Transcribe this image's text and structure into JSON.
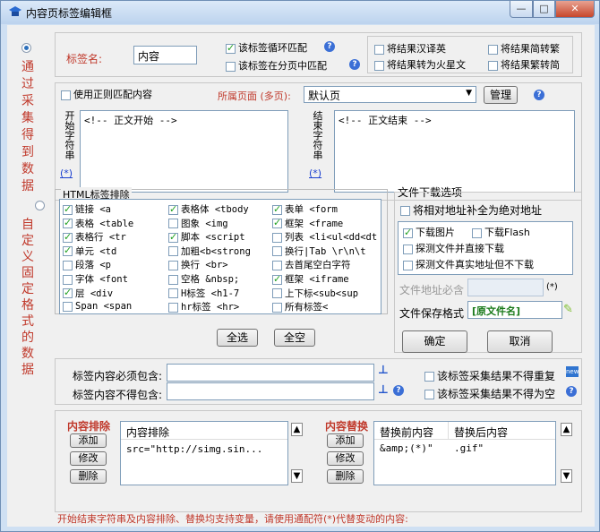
{
  "window": {
    "title": "内容页标签编辑框",
    "min": "—",
    "max": "□",
    "close": "✕"
  },
  "left": {
    "option1": "通过采集得到数据",
    "option2": "自定义固定格式的数据"
  },
  "tag": {
    "label": "标签名:",
    "value": "内容",
    "loop_label": "该标签循环匹配",
    "page_match_label": "该标签在分页中匹配",
    "to_simplified": "将结果汉译英",
    "to_martian": "将结果转为火星文",
    "to_trad": "将结果简转繁",
    "to_simp": "将结果繁转简"
  },
  "regex": {
    "label": "使用正则匹配内容",
    "page_label": "所属页面 (多页):",
    "page_select": "默认页",
    "manage": "管理"
  },
  "start": {
    "vlabel": "开始字符串",
    "text": "<!-- 正文开始 -->",
    "star": "(*)"
  },
  "end": {
    "vlabel": "结束字符串",
    "text": "<!-- 正文结束 -->",
    "star": "(*)"
  },
  "html": {
    "legend": "HTML标签排除",
    "items": [
      {
        "label": "链接 <a",
        "checked": true
      },
      {
        "label": "表格体 <tbody",
        "checked": true
      },
      {
        "label": "表单 <form",
        "checked": true
      },
      {
        "label": "表格 <table",
        "checked": true
      },
      {
        "label": "图象 <img",
        "checked": false
      },
      {
        "label": "框架 <frame",
        "checked": true
      },
      {
        "label": "表格行 <tr",
        "checked": true
      },
      {
        "label": "脚本 <script",
        "checked": true
      },
      {
        "label": "列表 <li<ul<dd<dt",
        "checked": false
      },
      {
        "label": "单元 <td",
        "checked": true
      },
      {
        "label": "加粗<b<strong",
        "checked": false
      },
      {
        "label": "换行|Tab \\r\\n\\t",
        "checked": false
      },
      {
        "label": "段落 <p",
        "checked": false
      },
      {
        "label": "换行 <br>",
        "checked": false
      },
      {
        "label": "去首尾空白字符",
        "checked": false
      },
      {
        "label": "字体 <font",
        "checked": false
      },
      {
        "label": "空格 &nbsp;",
        "checked": false
      },
      {
        "label": "框架 <iframe",
        "checked": true
      },
      {
        "label": "层 <div",
        "checked": true
      },
      {
        "label": "H标签 <h1-7",
        "checked": false
      },
      {
        "label": "上下标<sub<sup",
        "checked": false
      },
      {
        "label": "Span <span",
        "checked": false
      },
      {
        "label": "hr标签 <hr>",
        "checked": false
      },
      {
        "label": "所有标签<",
        "checked": false
      }
    ],
    "select_all": "全选",
    "select_none": "全空"
  },
  "download": {
    "legend": "文件下载选项",
    "absolute": "将相对地址补全为绝对地址",
    "download_images": "下载图片",
    "download_flash": "下载Flash",
    "detect_download": "探测文件并直接下载",
    "detect_real": "探测文件真实地址但不下载",
    "must_contain": "文件地址必含",
    "must_star": "(*)",
    "save_format_label": "文件保存格式",
    "save_format_value": "[原文件名]"
  },
  "actions": {
    "ok": "确定",
    "cancel": "取消"
  },
  "content_filter": {
    "must_contain": "标签内容必须包含:",
    "must_not_contain": "标签内容不得包含:",
    "no_dup": "该标签采集结果不得重复",
    "not_empty": "该标签采集结果不得为空",
    "new_badge": "new"
  },
  "exclude": {
    "title": "内容排除",
    "add": "添加",
    "edit": "修改",
    "delete": "删除",
    "header": "内容排除",
    "rows": [
      "src=\"http://simg.sin..."
    ]
  },
  "replace": {
    "title": "内容替换",
    "add": "添加",
    "edit": "修改",
    "delete": "删除",
    "header_before": "替换前内容",
    "header_after": "替换后内容",
    "rows": [
      {
        "before": "&amp;(*)\"",
        "after": ".gif\""
      }
    ]
  },
  "footer": "开始结束字符串及内容排除、替换均支持变量，请使用通配符(*)代替变动的内容:",
  "colors": {
    "accent_red": "#c0392b",
    "title_bg": "#cfe0f3"
  }
}
